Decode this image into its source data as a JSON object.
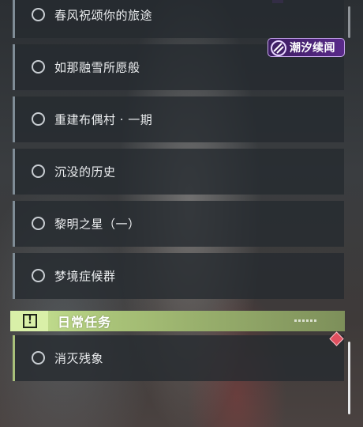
{
  "brand": {
    "logo_text": "潮汐续闻",
    "accent_color": "#5a2a8a"
  },
  "quests": [
    {
      "label": "春风祝颂你的旅途",
      "status": "incomplete"
    },
    {
      "label": "如那融雪所愿般",
      "status": "incomplete"
    },
    {
      "label": "重建布偶村 · 一期",
      "status": "incomplete"
    },
    {
      "label": "沉没的历史",
      "status": "incomplete"
    },
    {
      "label": "黎明之星（一）",
      "status": "incomplete"
    },
    {
      "label": "梦境症候群",
      "status": "incomplete"
    }
  ],
  "daily_section": {
    "title": "日常任务",
    "icon": "exclamation-box-icon",
    "accent_color": "#cbe797",
    "quests": [
      {
        "label": "消灭残象",
        "status": "incomplete"
      }
    ]
  },
  "indicator": {
    "icon": "diamond-marker-icon",
    "color": "#e05060"
  }
}
